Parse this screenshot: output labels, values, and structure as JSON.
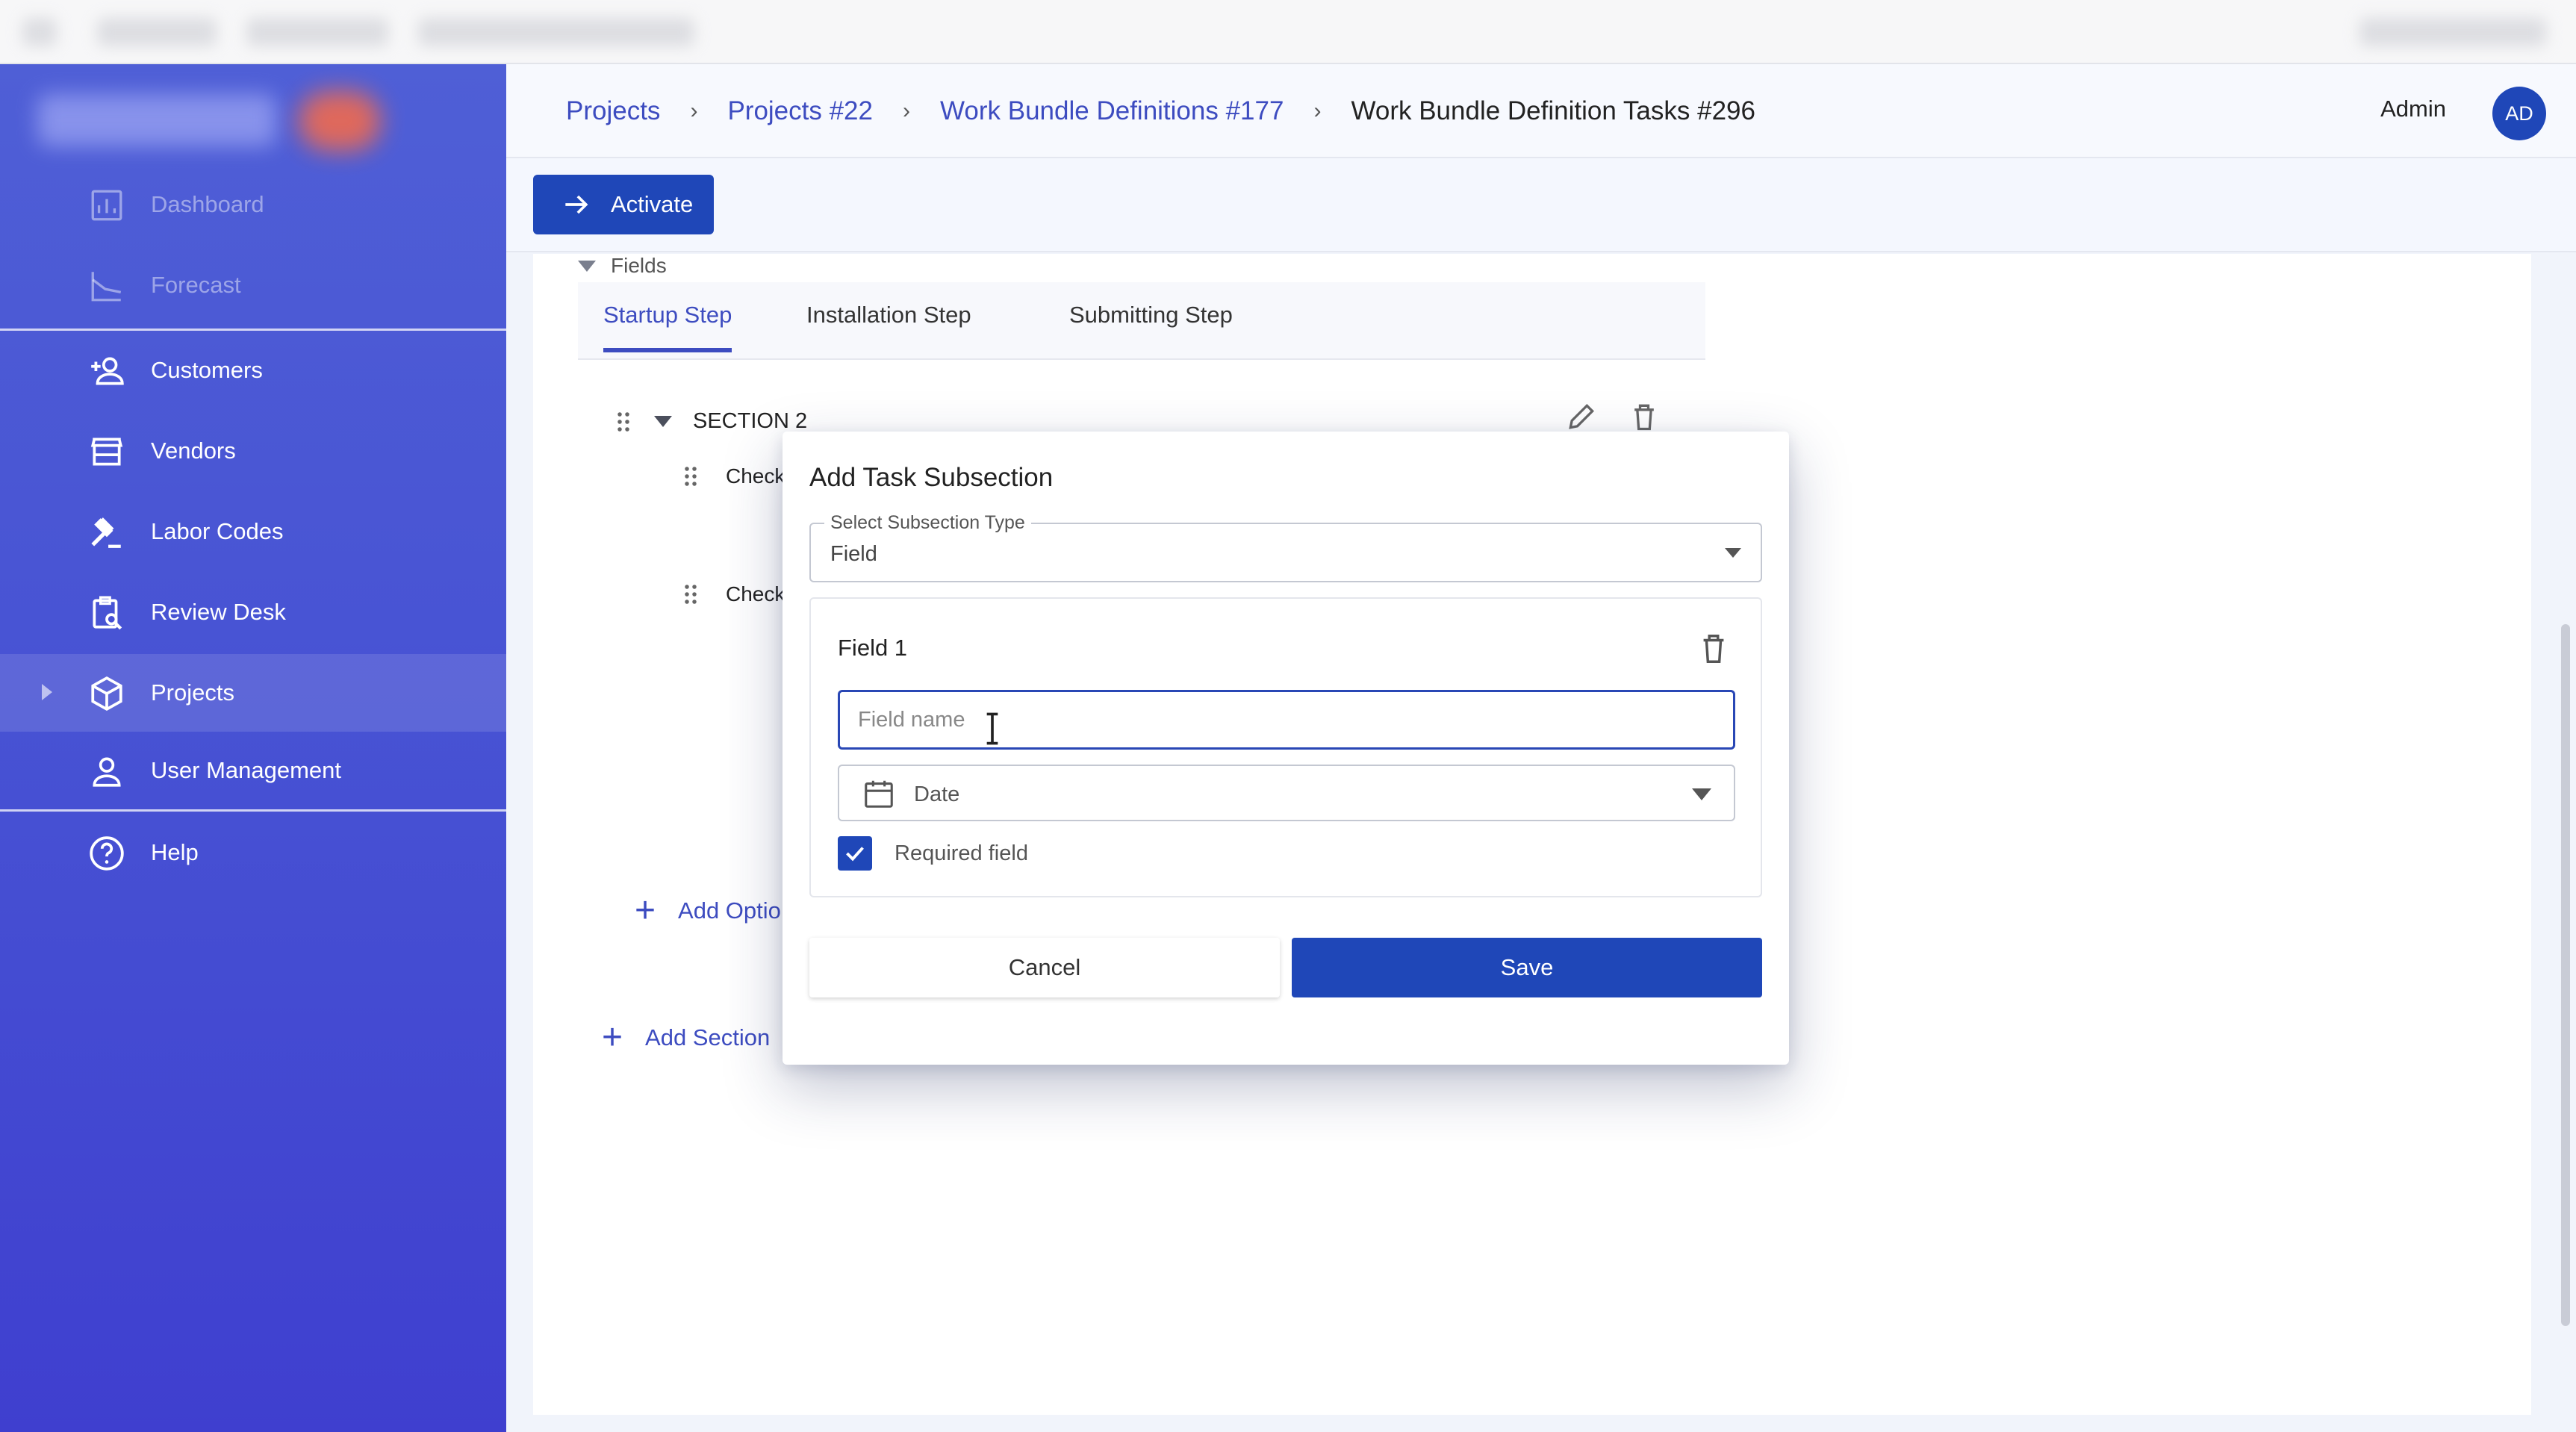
{
  "sidebar": {
    "items": [
      {
        "label": "Dashboard",
        "icon": "chart-icon"
      },
      {
        "label": "Forecast",
        "icon": "trend-icon"
      },
      {
        "label": "Customers",
        "icon": "add-person-icon"
      },
      {
        "label": "Vendors",
        "icon": "store-icon"
      },
      {
        "label": "Labor Codes",
        "icon": "gavel-icon"
      },
      {
        "label": "Review Desk",
        "icon": "clipboard-search-icon"
      },
      {
        "label": "Projects",
        "icon": "cube-icon"
      },
      {
        "label": "User Management",
        "icon": "person-icon"
      },
      {
        "label": "Help",
        "icon": "help-circle-icon"
      }
    ]
  },
  "header": {
    "breadcrumbs": [
      "Projects",
      "Projects #22",
      "Work Bundle Definitions #177",
      "Work Bundle Definition Tasks #296"
    ],
    "user_name": "Admin",
    "avatar_initials": "AD"
  },
  "toolbar": {
    "activate_label": "Activate"
  },
  "content": {
    "fields_label": "Fields",
    "tabs": [
      "Startup Step",
      "Installation Step",
      "Submitting Step"
    ],
    "section_title": "SECTION 2",
    "check_items": [
      "Checkl",
      "Checkl"
    ],
    "add_option_label": "Add Optio",
    "add_section_label": "Add Section"
  },
  "modal": {
    "title": "Add Task Subsection",
    "subsection_type_label": "Select Subsection Type",
    "subsection_type_value": "Field",
    "field_title": "Field 1",
    "field_name_placeholder": "Field name",
    "field_type_value": "Date",
    "required_label": "Required field",
    "required_checked": true,
    "cancel_label": "Cancel",
    "save_label": "Save"
  },
  "colors": {
    "primary": "#1f47b8",
    "sidebar": "#4650d3",
    "link": "#3d4cc0"
  }
}
